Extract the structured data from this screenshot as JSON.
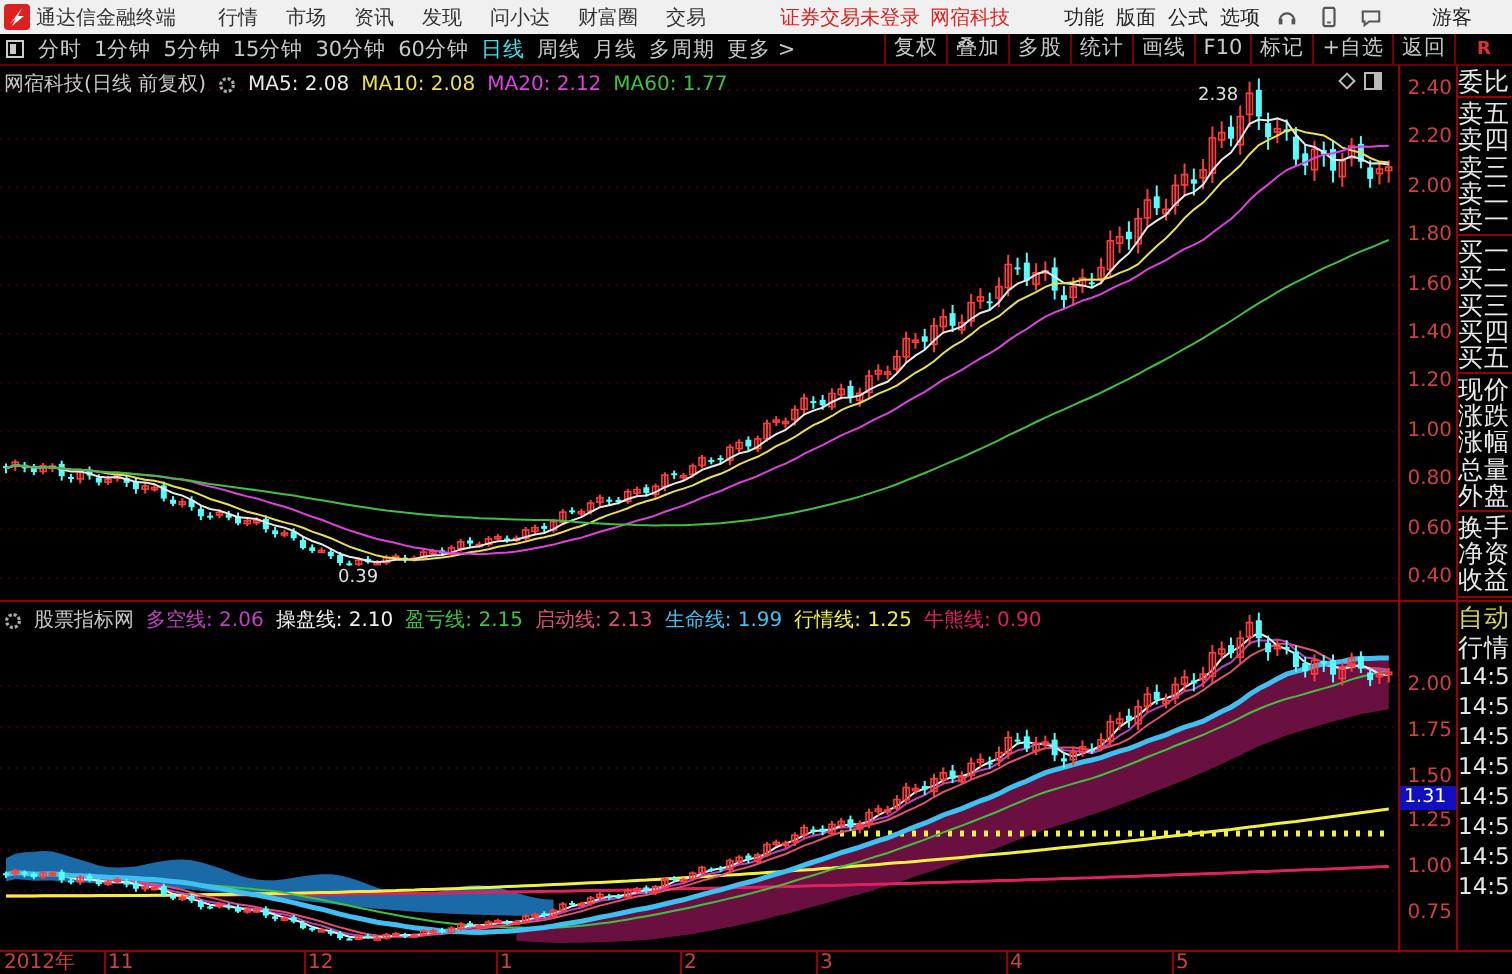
{
  "menubar": {
    "app_name": "通达信金融终端",
    "menus": [
      "行情",
      "市场",
      "资讯",
      "发现",
      "问小达",
      "财富圈",
      "交易"
    ],
    "notice": "证券交易未登录",
    "stock_name": "网宿科技",
    "tools": [
      "功能",
      "版面",
      "公式",
      "选项"
    ],
    "user": "游客"
  },
  "toolbar": {
    "periods": [
      {
        "label": "分时",
        "selected": false
      },
      {
        "label": "1分钟",
        "selected": false
      },
      {
        "label": "5分钟",
        "selected": false
      },
      {
        "label": "15分钟",
        "selected": false
      },
      {
        "label": "30分钟",
        "selected": false
      },
      {
        "label": "60分钟",
        "selected": false
      },
      {
        "label": "日线",
        "selected": true
      },
      {
        "label": "周线",
        "selected": false
      },
      {
        "label": "月线",
        "selected": false
      },
      {
        "label": "多周期",
        "selected": false
      }
    ],
    "more": "更多 >",
    "actions": [
      "复权",
      "叠加",
      "多股",
      "统计",
      "画线",
      "F10",
      "标记",
      "+自选",
      "返回"
    ],
    "corner": "R"
  },
  "main_chart": {
    "title": "网宿科技(日线 前复权)",
    "legend": [
      {
        "label": "MA5: 2.08",
        "color": "#e8e8e8"
      },
      {
        "label": "MA10: 2.08",
        "color": "#e8e050"
      },
      {
        "label": "MA20: 2.12",
        "color": "#e040e0"
      },
      {
        "label": "MA60: 1.77",
        "color": "#40c040"
      }
    ],
    "high_label": "2.38",
    "low_label": "0.39",
    "price_axis": [
      "2.40",
      "2.20",
      "2.00",
      "1.80",
      "1.60",
      "1.40",
      "1.20",
      "1.00",
      "0.80",
      "0.60",
      "0.40"
    ]
  },
  "indicator_chart": {
    "title": "股票指标网",
    "legend": [
      {
        "label": "多空线: 2.06",
        "color": "#c040c0"
      },
      {
        "label": "操盘线: 2.10",
        "color": "#f0f0f0"
      },
      {
        "label": "盈亏线: 2.15",
        "color": "#40c040"
      },
      {
        "label": "启动线: 2.13",
        "color": "#e05070"
      },
      {
        "label": "生命线: 1.99",
        "color": "#40c0f0"
      },
      {
        "label": "行情线: 1.25",
        "color": "#f0f040"
      },
      {
        "label": "牛熊线: 0.90",
        "color": "#e02060"
      }
    ],
    "price_axis": [
      "2.00",
      "1.75",
      "1.50",
      "1.25",
      "1.00",
      "0.75"
    ],
    "cursor_value": "1.31"
  },
  "time_axis": [
    "2012年",
    "11",
    "12",
    "1",
    "2",
    "3",
    "4",
    "5"
  ],
  "quote_panel": {
    "groups": [
      [
        "委比"
      ],
      [
        "卖五",
        "卖四",
        "卖三",
        "卖二",
        "卖一"
      ],
      [
        "买一",
        "买二",
        "买三",
        "买四",
        "买五"
      ],
      [
        "现价",
        "涨跌",
        "涨幅",
        "总量",
        "外盘"
      ],
      [
        "换手",
        "净资",
        "收益"
      ]
    ]
  },
  "tick_panel": {
    "mode": "自动",
    "title": "行情",
    "times": [
      "14:5",
      "14:5",
      "14:5",
      "14:5",
      "14:5",
      "14:5",
      "14:5",
      "14:5"
    ]
  }
}
